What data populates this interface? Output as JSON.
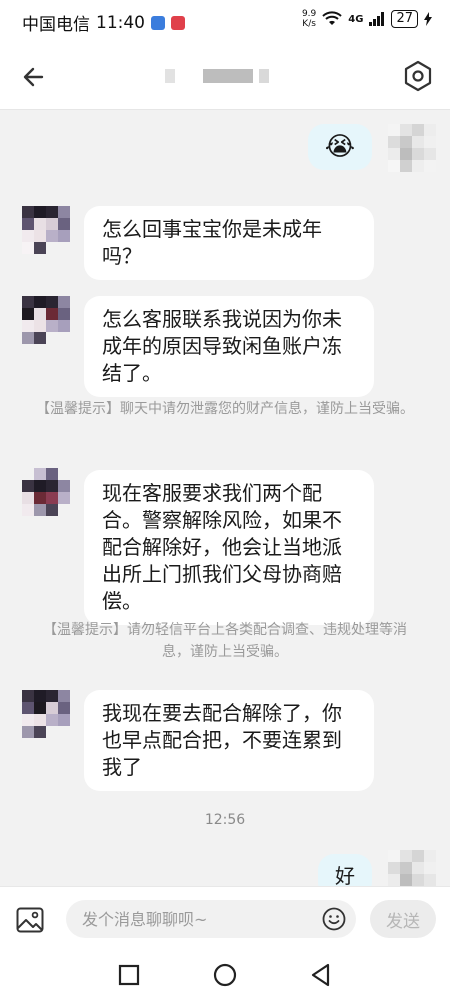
{
  "status_bar": {
    "carrier": "中国电信",
    "time": "11:40",
    "net_speed_value": "9.9",
    "net_speed_unit": "K/s",
    "signal_label": "4G",
    "battery": "27"
  },
  "header": {
    "title": "",
    "back_icon": "back-arrow-icon",
    "settings_icon": "hexagon-settings-icon"
  },
  "messages": [
    {
      "type": "outgoing",
      "emoji": "😭"
    },
    {
      "type": "incoming",
      "text": "怎么回事宝宝你是未成年吗？"
    },
    {
      "type": "incoming",
      "text": "怎么客服联系我说因为你未成年的原因导致闲鱼账户冻结了。"
    },
    {
      "type": "notice",
      "text": "【温馨提示】聊天中请勿泄露您的财产信息，谨防上当受骗。"
    },
    {
      "type": "incoming",
      "text": "现在客服要求我们两个配合。警察解除风险，如果不配合解除好，他会让当地派出所上门抓我们父母协商赔偿。"
    },
    {
      "type": "notice",
      "text": "【温馨提示】请勿轻信平台上各类配合调查、违规处理等消息，谨防上当受骗。"
    },
    {
      "type": "incoming",
      "text": "我现在要去配合解除了，你也早点配合把，不要连累到我了"
    },
    {
      "type": "time",
      "text": "12:56"
    },
    {
      "type": "outgoing",
      "text": "好"
    }
  ],
  "input_bar": {
    "placeholder": "发个消息聊聊呗~",
    "send_label": "发送"
  },
  "colors": {
    "outgoing_bubble": "#e6f6fb",
    "incoming_bubble": "#ffffff",
    "chat_background": "#f2f2f2",
    "notice_text": "#9a9a9a"
  }
}
